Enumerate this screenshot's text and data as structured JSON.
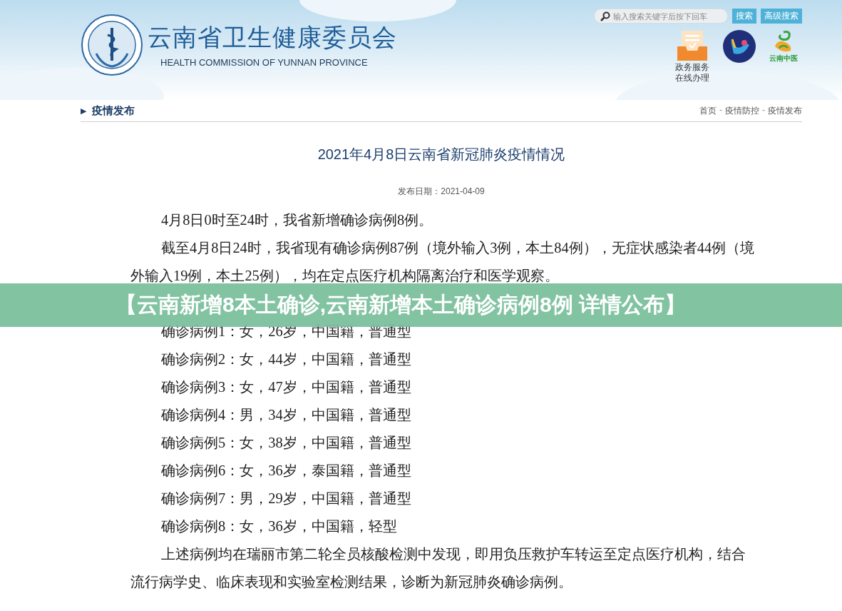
{
  "header": {
    "title": "云南省卫生健康委员会",
    "subtitle": "HEALTH COMMISSION OF YUNNAN PROVINCE",
    "search": {
      "placeholder": "输入搜索关键字后按下回车"
    },
    "buttons": [
      "搜索",
      "高级搜索"
    ],
    "service_link": [
      "政务服务",
      "在线办理"
    ],
    "partner_logo_text": "云南中医"
  },
  "section": {
    "marker": "▶",
    "title": "疫情发布"
  },
  "breadcrumb": [
    {
      "kind": "link",
      "text": "首页"
    },
    {
      "kind": "separator",
      "text": "-"
    },
    {
      "kind": "link",
      "text": "疫情防控"
    },
    {
      "kind": "separator",
      "text": "-"
    },
    {
      "kind": "link",
      "text": "疫情发布"
    }
  ],
  "article": {
    "title": "2021年4月8日云南省新冠肺炎疫情情况",
    "date": "发布日期：2021-04-09",
    "paragraphs": [
      "4月8日0时至24时，我省新增确诊病例8例。",
      "截至4月8日24时，我省现有确诊病例87例（境外输入3例，本土84例），无症状感染者44例（境外输入19例，本土25例），均在定点医疗机构隔离治疗和医学观察。",
      "确诊病例1：女，26岁，中国籍，普通型",
      "确诊病例2：女，44岁，中国籍，普通型",
      "确诊病例3：女，47岁，中国籍，普通型",
      "确诊病例4：男，34岁，中国籍，普通型",
      "确诊病例5：女，38岁，中国籍，普通型",
      "确诊病例6：女，36岁，泰国籍，普通型",
      "确诊病例7：男，29岁，中国籍，普通型",
      "确诊病例8：女，36岁，中国籍，轻型",
      "上述病例均在瑞丽市第二轮全员核酸检测中发现，即用负压救护车转运至定点医疗机构，结合流行病学史、临床表现和实验室检测结果，诊断为新冠肺炎确诊病例。"
    ]
  },
  "banner": "【云南新增8本土确诊,云南新增本土确诊病例8例 详情公布】"
}
